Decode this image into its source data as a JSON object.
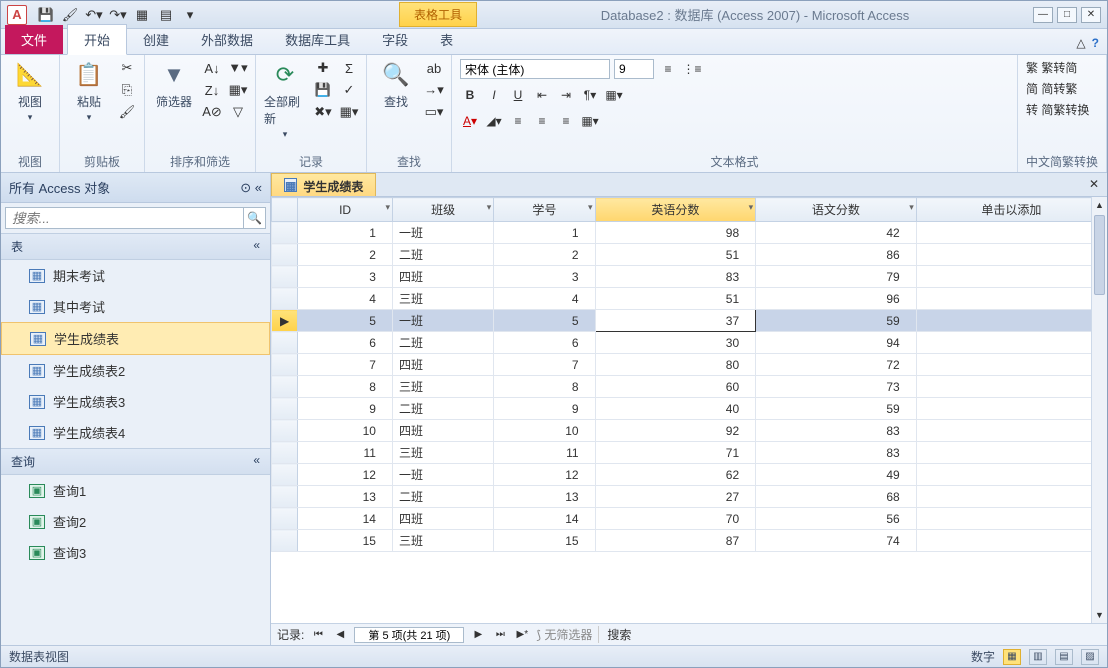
{
  "app_icon": "A",
  "window_title": "Database2 : 数据库 (Access 2007) - Microsoft Access",
  "context_tab": "表格工具",
  "tabs": {
    "file": "文件",
    "home": "开始",
    "create": "创建",
    "external": "外部数据",
    "dbtools": "数据库工具",
    "fields": "字段",
    "table": "表"
  },
  "ribbon": {
    "view": {
      "label": "视图",
      "btn": "视图"
    },
    "clipboard": {
      "label": "剪贴板",
      "btn": "粘贴"
    },
    "sort": {
      "label": "排序和筛选",
      "filter": "筛选器"
    },
    "records": {
      "label": "记录",
      "refresh": "全部刷新"
    },
    "find": {
      "label": "查找",
      "btn": "查找"
    },
    "textfmt": {
      "label": "文本格式",
      "font_name": "宋体 (主体)",
      "font_size": "9"
    },
    "chinese": {
      "label": "中文简繁转换",
      "sc": "繁转简",
      "tc": "简转繁",
      "cv": "简繁转换"
    }
  },
  "nav": {
    "header": "所有 Access 对象",
    "search_placeholder": "搜索...",
    "section_tables": "表",
    "section_queries": "查询",
    "tables": [
      "期末考试",
      "其中考试",
      "学生成绩表",
      "学生成绩表2",
      "学生成绩表3",
      "学生成绩表4"
    ],
    "selected_table_index": 2,
    "queries": [
      "查询1",
      "查询2",
      "查询3"
    ]
  },
  "doc": {
    "tab_title": "学生成绩表",
    "columns": [
      "ID",
      "班级",
      "学号",
      "英语分数",
      "语文分数",
      "单击以添加"
    ],
    "selected_col": 3,
    "selected_row": 4,
    "rows": [
      {
        "id": 1,
        "cls": "一班",
        "xh": 1,
        "en": 98,
        "cn": 42
      },
      {
        "id": 2,
        "cls": "二班",
        "xh": 2,
        "en": 51,
        "cn": 86
      },
      {
        "id": 3,
        "cls": "四班",
        "xh": 3,
        "en": 83,
        "cn": 79
      },
      {
        "id": 4,
        "cls": "三班",
        "xh": 4,
        "en": 51,
        "cn": 96
      },
      {
        "id": 5,
        "cls": "一班",
        "xh": 5,
        "en": 37,
        "cn": 59
      },
      {
        "id": 6,
        "cls": "二班",
        "xh": 6,
        "en": 30,
        "cn": 94
      },
      {
        "id": 7,
        "cls": "四班",
        "xh": 7,
        "en": 80,
        "cn": 72
      },
      {
        "id": 8,
        "cls": "三班",
        "xh": 8,
        "en": 60,
        "cn": 73
      },
      {
        "id": 9,
        "cls": "二班",
        "xh": 9,
        "en": 40,
        "cn": 59
      },
      {
        "id": 10,
        "cls": "四班",
        "xh": 10,
        "en": 92,
        "cn": 83
      },
      {
        "id": 11,
        "cls": "三班",
        "xh": 11,
        "en": 71,
        "cn": 83
      },
      {
        "id": 12,
        "cls": "一班",
        "xh": 12,
        "en": 62,
        "cn": 49
      },
      {
        "id": 13,
        "cls": "二班",
        "xh": 13,
        "en": 27,
        "cn": 68
      },
      {
        "id": 14,
        "cls": "四班",
        "xh": 14,
        "en": 70,
        "cn": 56
      },
      {
        "id": 15,
        "cls": "三班",
        "xh": 15,
        "en": 87,
        "cn": 74
      }
    ]
  },
  "recnav": {
    "label": "记录:",
    "pos": "第 5 项(共 21 项)",
    "nofilter": "无筛选器",
    "search": "搜索"
  },
  "status": {
    "left": "数据表视图",
    "mode": "数字"
  }
}
